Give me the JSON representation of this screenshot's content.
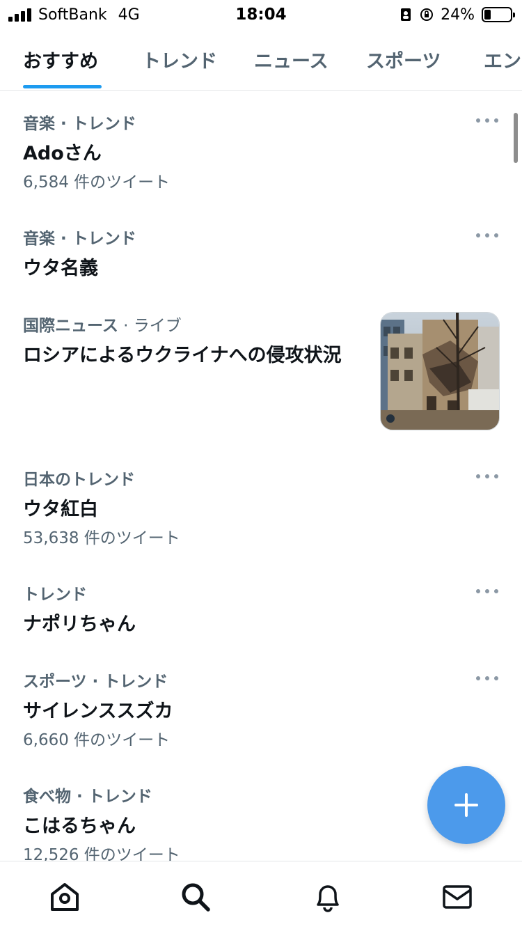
{
  "status_bar": {
    "carrier": "SoftBank",
    "network": "4G",
    "time": "18:04",
    "battery_percent": "24%",
    "battery_level": 0.24,
    "icons": [
      "signal-icon",
      "id-card-icon",
      "orientation-lock-icon",
      "battery-icon"
    ]
  },
  "tabs": [
    {
      "label": "おすすめ",
      "active": true
    },
    {
      "label": "トレンド",
      "active": false
    },
    {
      "label": "ニュース",
      "active": false
    },
    {
      "label": "スポーツ",
      "active": false
    },
    {
      "label": "エン",
      "active": false
    }
  ],
  "trends": [
    {
      "meta": "音楽 · トレンド",
      "title": "Adoさん",
      "count": "6,584 件のツイート"
    },
    {
      "meta": "音楽 · トレンド",
      "title": "ウタ名義",
      "count": ""
    },
    {
      "meta": "国際ニュース",
      "meta_sub": " · ライブ",
      "title": "ロシアによるウクライナへの侵攻状況",
      "count": ""
    },
    {
      "meta": "日本のトレンド",
      "title": "ウタ紅白",
      "count": "53,638 件のツイート"
    },
    {
      "meta": "トレンド",
      "title": "ナポリちゃん",
      "count": ""
    },
    {
      "meta": "スポーツ · トレンド",
      "title": "サイレンススズカ",
      "count": "6,660 件のツイート"
    },
    {
      "meta": "食べ物 · トレンド",
      "title": "こはるちゃん",
      "count": "12,526 件のツイート"
    }
  ],
  "colors": {
    "accent": "#1d9bf0",
    "fab": "#4c9aeb",
    "secondary_text": "#536471",
    "primary_text": "#0f1419"
  },
  "bottom_nav": [
    "home-icon",
    "search-icon",
    "bell-icon",
    "mail-icon"
  ]
}
